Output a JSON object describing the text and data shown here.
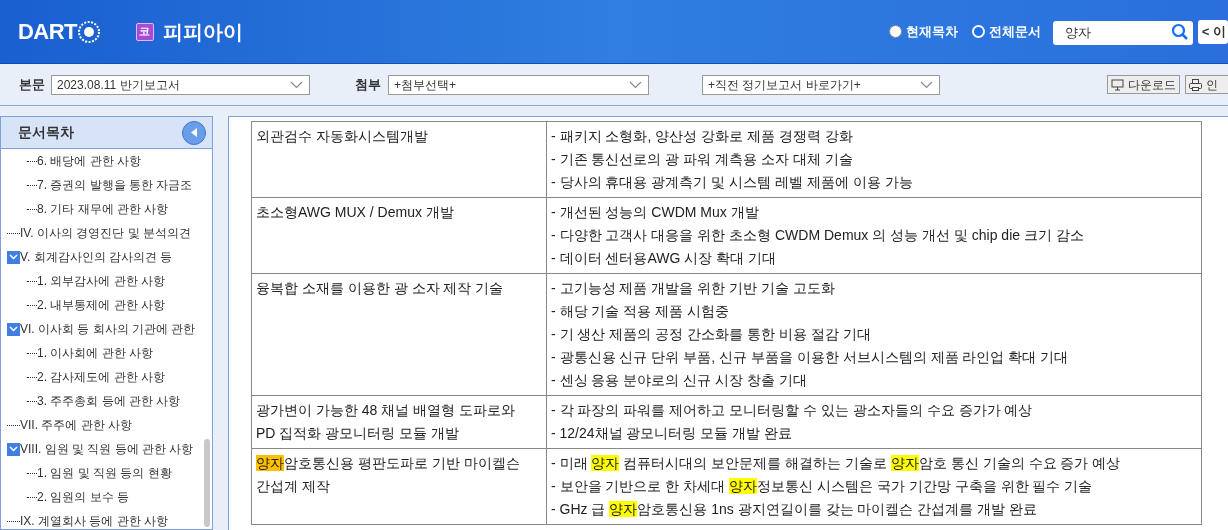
{
  "header": {
    "logo": "DART",
    "company_badge": "코",
    "company": "피피아이",
    "scope_options": [
      {
        "label": "현재목차",
        "selected": false
      },
      {
        "label": "전체문서",
        "selected": true
      }
    ],
    "search": {
      "value": "양자"
    },
    "prev_button": "< 이"
  },
  "toolbar": {
    "body_label": "본문",
    "body_select": "2023.08.11  반기보고서",
    "attach_label": "첨부",
    "attach_select": "+첨부선택+",
    "shortcut_select": "+직전 정기보고서 바로가기+",
    "download_button": "다운로드",
    "print_button": "인"
  },
  "sidebar": {
    "title": "문서목차",
    "items": [
      {
        "children": [
          {
            "label": "6. 배당에 관한 사항"
          },
          {
            "label": "7. 증권의 발행을 통한 자금조"
          },
          {
            "label": "8. 기타 재무에 관한 사항"
          }
        ]
      },
      {
        "label": "IV. 이사의 경영진단 및 분석의견"
      },
      {
        "label": "V. 회계감사인의 감사의견 등",
        "expanded": true,
        "children": [
          {
            "label": "1. 외부감사에 관한 사항"
          },
          {
            "label": "2. 내부통제에 관한 사항"
          }
        ]
      },
      {
        "label": "VI. 이사회 등 회사의 기관에 관한",
        "expanded": true,
        "children": [
          {
            "label": "1. 이사회에 관한 사항"
          },
          {
            "label": "2. 감사제도에 관한 사항"
          },
          {
            "label": "3. 주주총회 등에 관한 사항"
          }
        ]
      },
      {
        "label": "VII. 주주에 관한 사항"
      },
      {
        "label": "VIII. 임원 및 직원 등에 관한 사항",
        "expanded": true,
        "children": [
          {
            "label": "1. 임원 및 직원 등의 현황"
          },
          {
            "label": "2. 임원의 보수 등"
          }
        ]
      },
      {
        "label": "IX. 계열회사 등에 관한 사항"
      }
    ]
  },
  "table": {
    "rows": [
      {
        "title": [
          [
            "외관검수 자동화시스템개발"
          ]
        ],
        "effects": [
          [
            "- 패키지 소형화, 양산성 강화로 제품 경쟁력 강화"
          ],
          [
            "- 기존 통신선로의 광 파워 계측용 소자 대체 기술"
          ],
          [
            "- 당사의 휴대용 광계측기 및 시스템 레벨 제품에 이용 가능"
          ]
        ]
      },
      {
        "title": [
          [
            "초소형AWG MUX / Demux 개발"
          ]
        ],
        "effects": [
          [
            "- 개선된 성능의 CWDM Mux 개발"
          ],
          [
            "- 다양한 고객사 대응을 위한 초소형 CWDM Demux 의 성능 개선 및 chip die 크기 감소"
          ],
          [
            "- 데이터 센터용AWG 시장 확대 기대"
          ]
        ]
      },
      {
        "title": [
          [
            "융복합 소재를 이용한 광 소자 제작 기술"
          ]
        ],
        "effects": [
          [
            "- 고기능성 제품 개발을 위한 기반 기술 고도화"
          ],
          [
            "- 해당 기술 적용 제품 시험중"
          ],
          [
            "- 기 생산 제품의 공정 간소화를 통한 비용 절감 기대"
          ],
          [
            "- 광통신용 신규 단위 부품, 신규 부품을 이용한 서브시스템의 제품 라인업 확대 기대"
          ],
          [
            "- 센싱 응용 분야로의 신규 시장 창출 기대"
          ]
        ]
      },
      {
        "title": [
          [
            "광가변이 가능한 48 채널 배열형 도파로와"
          ],
          [
            "PD 집적화 광모니터링 모듈 개발"
          ]
        ],
        "effects": [
          [
            "- 각 파장의 파워를 제어하고 모니터링할 수 있는 광소자들의 수요 증가가 예상"
          ],
          [
            "- 12/24채널 광모니터링 모듈 개발 완료"
          ]
        ]
      },
      {
        "title": [
          [
            {
              "text": "양자",
              "color": "#ffc000"
            },
            "암호통신용 평판도파로 기반 마이켈슨"
          ],
          [
            "간섭계 제작"
          ]
        ],
        "effects": [
          [
            "- 미래 ",
            {
              "text": "양자",
              "color": "#ffff00"
            },
            " 컴퓨터시대의 보안문제를 해결하는 기술로 ",
            {
              "text": "양자",
              "color": "#ffff00"
            },
            "암호 통신 기술의 수요 증가 예상"
          ],
          [
            "- 보안을 기반으로 한 차세대 ",
            {
              "text": "양자",
              "color": "#ffff00"
            },
            "정보통신 시스템은 국가 기간망 구축을 위한 필수 기술"
          ],
          [
            "- GHz 급 ",
            {
              "text": "양자",
              "color": "#ffff00"
            },
            "암호통신용 1ns 광지연길이를 갖는 마이켈슨 간섭계를 개발 완료"
          ]
        ]
      }
    ]
  }
}
